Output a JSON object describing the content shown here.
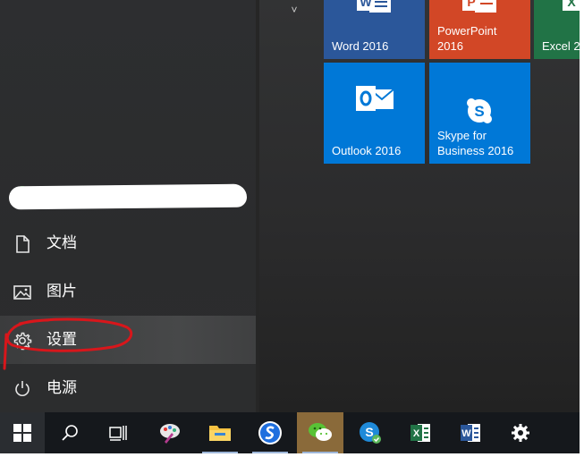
{
  "start_menu": {
    "user": {
      "name": "",
      "avatar_color": "#38a537"
    },
    "nav_items": [
      {
        "id": "documents",
        "label": "文档",
        "icon": "document-icon"
      },
      {
        "id": "pictures",
        "label": "图片",
        "icon": "picture-icon"
      },
      {
        "id": "settings",
        "label": "设置",
        "icon": "gear-icon",
        "highlighted": true
      },
      {
        "id": "power",
        "label": "电源",
        "icon": "power-icon"
      }
    ],
    "group_chevron": "˅"
  },
  "tiles": [
    {
      "id": "word",
      "label": "Word 2016",
      "color": "#2b579a",
      "icon": "word-icon"
    },
    {
      "id": "powerpoint",
      "label": "PowerPoint 2016",
      "color": "#d24726",
      "icon": "powerpoint-icon"
    },
    {
      "id": "excel",
      "label": "Excel 2",
      "color": "#217346",
      "icon": "excel-icon"
    },
    {
      "id": "outlook",
      "label": "Outlook 2016",
      "color": "#0078d7",
      "icon": "outlook-icon"
    },
    {
      "id": "skype",
      "label": "Skype for Business 2016",
      "color": "#0078d7",
      "icon": "skype-icon"
    }
  ],
  "taskbar": {
    "items": [
      {
        "id": "start",
        "icon": "windows-logo-icon"
      },
      {
        "id": "search",
        "icon": "search-icon"
      },
      {
        "id": "task-view",
        "icon": "task-view-icon"
      },
      {
        "id": "paint",
        "icon": "paint-icon"
      },
      {
        "id": "file-explorer",
        "icon": "folder-icon"
      },
      {
        "id": "sogou",
        "icon": "sogou-icon"
      },
      {
        "id": "wechat",
        "icon": "wechat-icon",
        "active": true
      },
      {
        "id": "skype-business",
        "icon": "skype-icon"
      },
      {
        "id": "excel",
        "icon": "excel-icon"
      },
      {
        "id": "word",
        "icon": "word-icon"
      },
      {
        "id": "settings",
        "icon": "gear-icon"
      }
    ]
  },
  "annotation": {
    "color": "#d8161b",
    "shape": "hand-drawn ellipse around 设置"
  }
}
